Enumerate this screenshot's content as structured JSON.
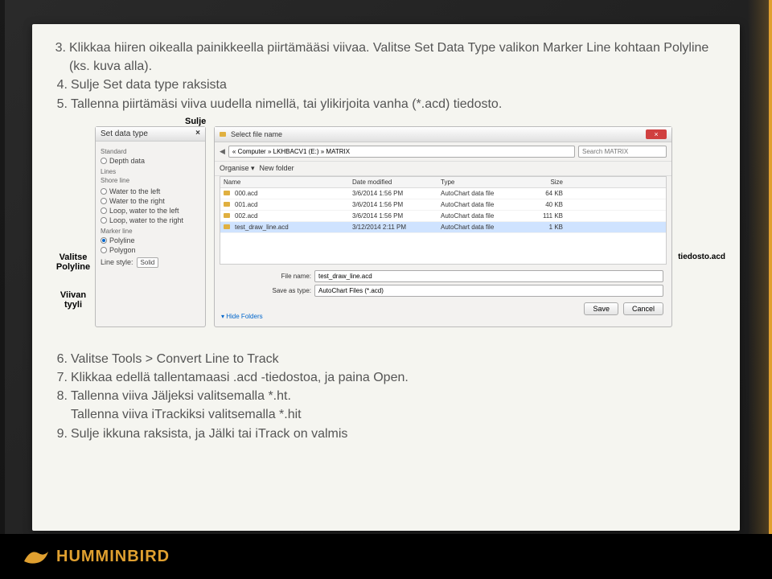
{
  "instructions_top": [
    {
      "n": "3.",
      "text": "Klikkaa hiiren oikealla painikkeella piirtämääsi viivaa. Valitse Set Data Type valikon Marker Line kohtaan Polyline (ks. kuva alla)."
    },
    {
      "n": "4.",
      "text": "Sulje Set data type raksista"
    },
    {
      "n": "5.",
      "text": "Tallenna piirtämäsi viiva uudella nimellä, tai ylikirjoita vanha (*.acd) tiedosto."
    }
  ],
  "labels": {
    "sulje": "Sulje",
    "valitse_polyline": "Valitse Polyline",
    "viivan_tyyli": "Viivan tyyli",
    "tiedosto_acd": "tiedosto.acd"
  },
  "set_data_type": {
    "title": "Set data type",
    "groups": {
      "standard": "Standard",
      "lines": "Lines",
      "marker": "Marker line",
      "linestyle_label": "Line style:"
    },
    "options": {
      "depth": "Depth data",
      "shore": "Shore line",
      "water_left": "Water to the left",
      "water_right": "Water to the right",
      "loop_left": "Loop, water to the left",
      "loop_right": "Loop, water to the right",
      "polyline": "Polyline",
      "polygon": "Polygon",
      "linestyle_value": "Solid"
    }
  },
  "file_dialog": {
    "title": "Select file name",
    "path": "« Computer » LKHBACV1 (E:) » MATRIX",
    "search_placeholder": "Search MATRIX",
    "toolbar": {
      "organise": "Organise ▾",
      "newfolder": "New folder"
    },
    "headers": {
      "name": "Name",
      "date": "Date modified",
      "type": "Type",
      "size": "Size"
    },
    "rows": [
      {
        "name": "000.acd",
        "date": "3/6/2014 1:56 PM",
        "type": "AutoChart data file",
        "size": "64 KB"
      },
      {
        "name": "001.acd",
        "date": "3/6/2014 1:56 PM",
        "type": "AutoChart data file",
        "size": "40 KB"
      },
      {
        "name": "002.acd",
        "date": "3/6/2014 1:56 PM",
        "type": "AutoChart data file",
        "size": "111 KB"
      },
      {
        "name": "test_draw_line.acd",
        "date": "3/12/2014 2:11 PM",
        "type": "AutoChart data file",
        "size": "1 KB"
      }
    ],
    "filename_label": "File name:",
    "filename": "test_draw_line.acd",
    "saveas_label": "Save as type:",
    "saveas": "AutoChart Files (*.acd)",
    "hide_folders": "Hide Folders",
    "save": "Save",
    "cancel": "Cancel"
  },
  "instructions_bottom": [
    {
      "n": "6.",
      "text": "Valitse Tools > Convert Line to Track"
    },
    {
      "n": "7.",
      "text": "Klikkaa edellä tallentamaasi .acd -tiedostoa, ja paina Open."
    },
    {
      "n": "8.",
      "text": "Tallenna viiva Jäljeksi valitsemalla *.ht.",
      "extra": "Tallenna viiva iTrackiksi valitsemalla *.hit"
    },
    {
      "n": "9.",
      "text": "Sulje ikkuna raksista, ja Jälki tai iTrack on valmis"
    }
  ],
  "brand": "HUMMINBIRD"
}
